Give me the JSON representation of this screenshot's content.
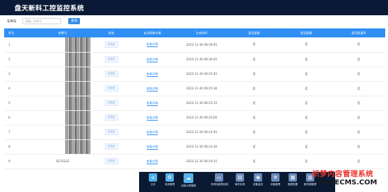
{
  "app": {
    "title": "盘天新科工控监控系统"
  },
  "search": {
    "label": "车牌号",
    "placeholder": "请输入车牌号",
    "button": "查询"
  },
  "table": {
    "columns": [
      "序号",
      "车牌号",
      "状态",
      "自动驾驶详情",
      "生成时间",
      "是否超载",
      "是否超载",
      "是否超速率"
    ],
    "rows": [
      {
        "index": "1",
        "plate": "",
        "status": "已检查",
        "detail": "查看详情",
        "time": "2022-11-30 06:39:45",
        "c6": "否",
        "c7": "否",
        "c8": "否"
      },
      {
        "index": "2",
        "plate": "",
        "status": "已检查",
        "detail": "查看详情",
        "time": "2022-11-30 06:36:45",
        "c6": "否",
        "c7": "否",
        "c8": "否"
      },
      {
        "index": "3",
        "plate": "",
        "status": "已检查",
        "detail": "查看详情",
        "time": "2022-11-30 06:25:45",
        "c6": "否",
        "c7": "否",
        "c8": "否"
      },
      {
        "index": "4",
        "plate": "",
        "status": "已检查",
        "detail": "查看详情",
        "time": "2022-11-30 06:25:30",
        "c6": "否",
        "c7": "否",
        "c8": "否"
      },
      {
        "index": "5",
        "plate": "",
        "status": "已检查",
        "detail": "查看详情",
        "time": "2022-11-30 06:25:15",
        "c6": "否",
        "c7": "否",
        "c8": "否"
      },
      {
        "index": "6",
        "plate": "",
        "status": "已检查",
        "detail": "查看详情",
        "time": "2022-11-30 06:25:00",
        "c6": "否",
        "c7": "否",
        "c8": "否"
      },
      {
        "index": "7",
        "plate": "",
        "status": "已检查",
        "detail": "查看详情",
        "time": "2022-11-30 06:24:45",
        "c6": "否",
        "c7": "否",
        "c8": "否"
      },
      {
        "index": "8",
        "plate": "",
        "status": "已检查",
        "detail": "查看详情",
        "time": "2022-11-30 06:24:30",
        "c6": "否",
        "c7": "否",
        "c8": "否"
      },
      {
        "index": "9",
        "plate": "SG7622S",
        "status": "已检查",
        "detail": "查看详情",
        "time": "2022-11-30 06:24:15",
        "c6": "否",
        "c7": "否",
        "c8": "否"
      }
    ]
  },
  "dock": {
    "items": [
      {
        "label": "主页",
        "icon": "home-icon"
      },
      {
        "label": "系统管理",
        "icon": "settings-icon"
      },
      {
        "label": "边缘计算管理",
        "icon": "cloud-icon"
      },
      {
        "label": "非现场超载检测",
        "icon": "monitor-icon"
      },
      {
        "label": "事件检测",
        "icon": "event-icon"
      },
      {
        "label": "设备监控",
        "icon": "device-icon"
      },
      {
        "label": "设备管理",
        "icon": "gear-icon"
      },
      {
        "label": "数据配置",
        "icon": "database-icon"
      },
      {
        "label": "服务器管理",
        "icon": "server-icon"
      }
    ]
  },
  "watermark": {
    "cn": "织梦内容管理系统",
    "en": "DEDECMS.COM"
  },
  "colors": {
    "header": "#0a1a36",
    "accent": "#2f8ff5",
    "dock": "#0b1a33"
  }
}
